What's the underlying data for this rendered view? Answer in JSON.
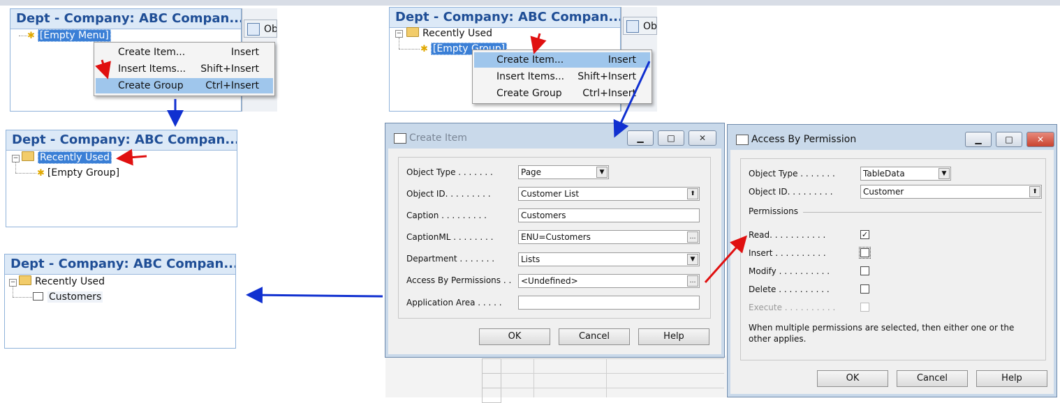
{
  "panels": {
    "p1": {
      "title": "Dept - Company: ABC Compan...",
      "node": "[Empty Menu]",
      "tab": "Ob"
    },
    "p2": {
      "title": "Dept - Company: ABC Compan...",
      "node1": "Recently Used",
      "node2": "[Empty Group]",
      "tab": "Ob"
    },
    "p3": {
      "title": "Dept - Company: ABC Compan...",
      "node1": "Recently Used",
      "node2": "[Empty Group]"
    },
    "p4": {
      "title": "Dept - Company: ABC Compan...",
      "node1": "Recently Used",
      "node2": "Customers"
    }
  },
  "menu1": [
    {
      "label": "Create Item...",
      "key": "Insert"
    },
    {
      "label": "Insert Items...",
      "key": "Shift+Insert"
    },
    {
      "label": "Create Group",
      "key": "Ctrl+Insert"
    }
  ],
  "menu2": [
    {
      "label": "Create Item...",
      "key": "Insert"
    },
    {
      "label": "Insert Items...",
      "key": "Shift+Insert"
    },
    {
      "label": "Create Group",
      "key": "Ctrl+Insert"
    }
  ],
  "create_item": {
    "title": "Create Item",
    "fields": [
      {
        "label": "Object Type  . . . . . . .",
        "value": "Page"
      },
      {
        "label": "Object ID. . . . . . . . .",
        "value": "Customer List"
      },
      {
        "label": "Caption  . . . . . . . . .",
        "value": "Customers"
      },
      {
        "label": "CaptionML  . . . . . . . .",
        "value": "ENU=Customers"
      },
      {
        "label": "Department  . . . . . . .",
        "value": "Lists"
      },
      {
        "label": "Access By Permissions  . .",
        "value": "<Undefined>"
      },
      {
        "label": "Application Area  . . . . .",
        "value": ""
      }
    ],
    "buttons": {
      "ok": "OK",
      "cancel": "Cancel",
      "help": "Help"
    }
  },
  "access": {
    "title": "Access By Permission",
    "object_type_label": "Object Type  . . . . . . .",
    "object_type": "TableData",
    "object_id_label": "Object ID. . . . . . . . .",
    "object_id": "Customer",
    "permissions_header": "Permissions",
    "perms": [
      {
        "label": "Read. . . . . . . . . . .",
        "checked": true
      },
      {
        "label": "Insert  . . . . . . . . . .",
        "checked": false
      },
      {
        "label": "Modify  . . . . . . . . . .",
        "checked": false
      },
      {
        "label": "Delete  . . . . . . . . . .",
        "checked": false
      },
      {
        "label": "Execute  . . . . . . . . . .",
        "checked": false
      }
    ],
    "note": "When multiple permissions are selected, then either one or the other applies.",
    "buttons": {
      "ok": "OK",
      "cancel": "Cancel",
      "help": "Help"
    }
  },
  "colors": {
    "title_blue": "#1f4e96",
    "selection": "#3a7fd6",
    "menu_highlight": "#9fc6ec",
    "arrow_red": "#e01010",
    "arrow_blue": "#1030d0"
  }
}
